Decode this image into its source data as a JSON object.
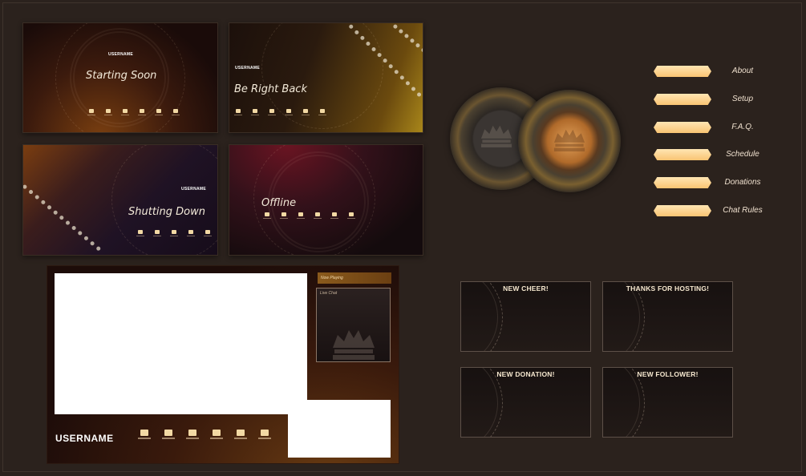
{
  "screens": {
    "starting": {
      "username": "USERNAME",
      "title": "Starting Soon"
    },
    "brb": {
      "username": "USERNAME",
      "title": "Be Right Back"
    },
    "shutting": {
      "username": "USERNAME",
      "title": "Shutting Down"
    },
    "offline": {
      "title": "Offline"
    }
  },
  "social_icons": [
    "discord-icon",
    "twitter-icon",
    "facebook-icon",
    "instagram-icon",
    "youtube-icon",
    "tiktok-icon"
  ],
  "overlay": {
    "now_playing": "Now Playing",
    "live_chat": "Live Chat",
    "username": "USERNAME"
  },
  "panels": [
    {
      "label": "About"
    },
    {
      "label": "Setup"
    },
    {
      "label": "F.A.Q."
    },
    {
      "label": "Schedule"
    },
    {
      "label": "Donations"
    },
    {
      "label": "Chat Rules"
    }
  ],
  "alerts": [
    {
      "label": "NEW CHEER!"
    },
    {
      "label": "THANKS FOR HOSTING!"
    },
    {
      "label": "NEW DONATION!"
    },
    {
      "label": "NEW FOLLOWER!"
    }
  ],
  "colors": {
    "background": "#2b221d",
    "accent_gold": "#f9c473",
    "glow": "#f2a650"
  }
}
